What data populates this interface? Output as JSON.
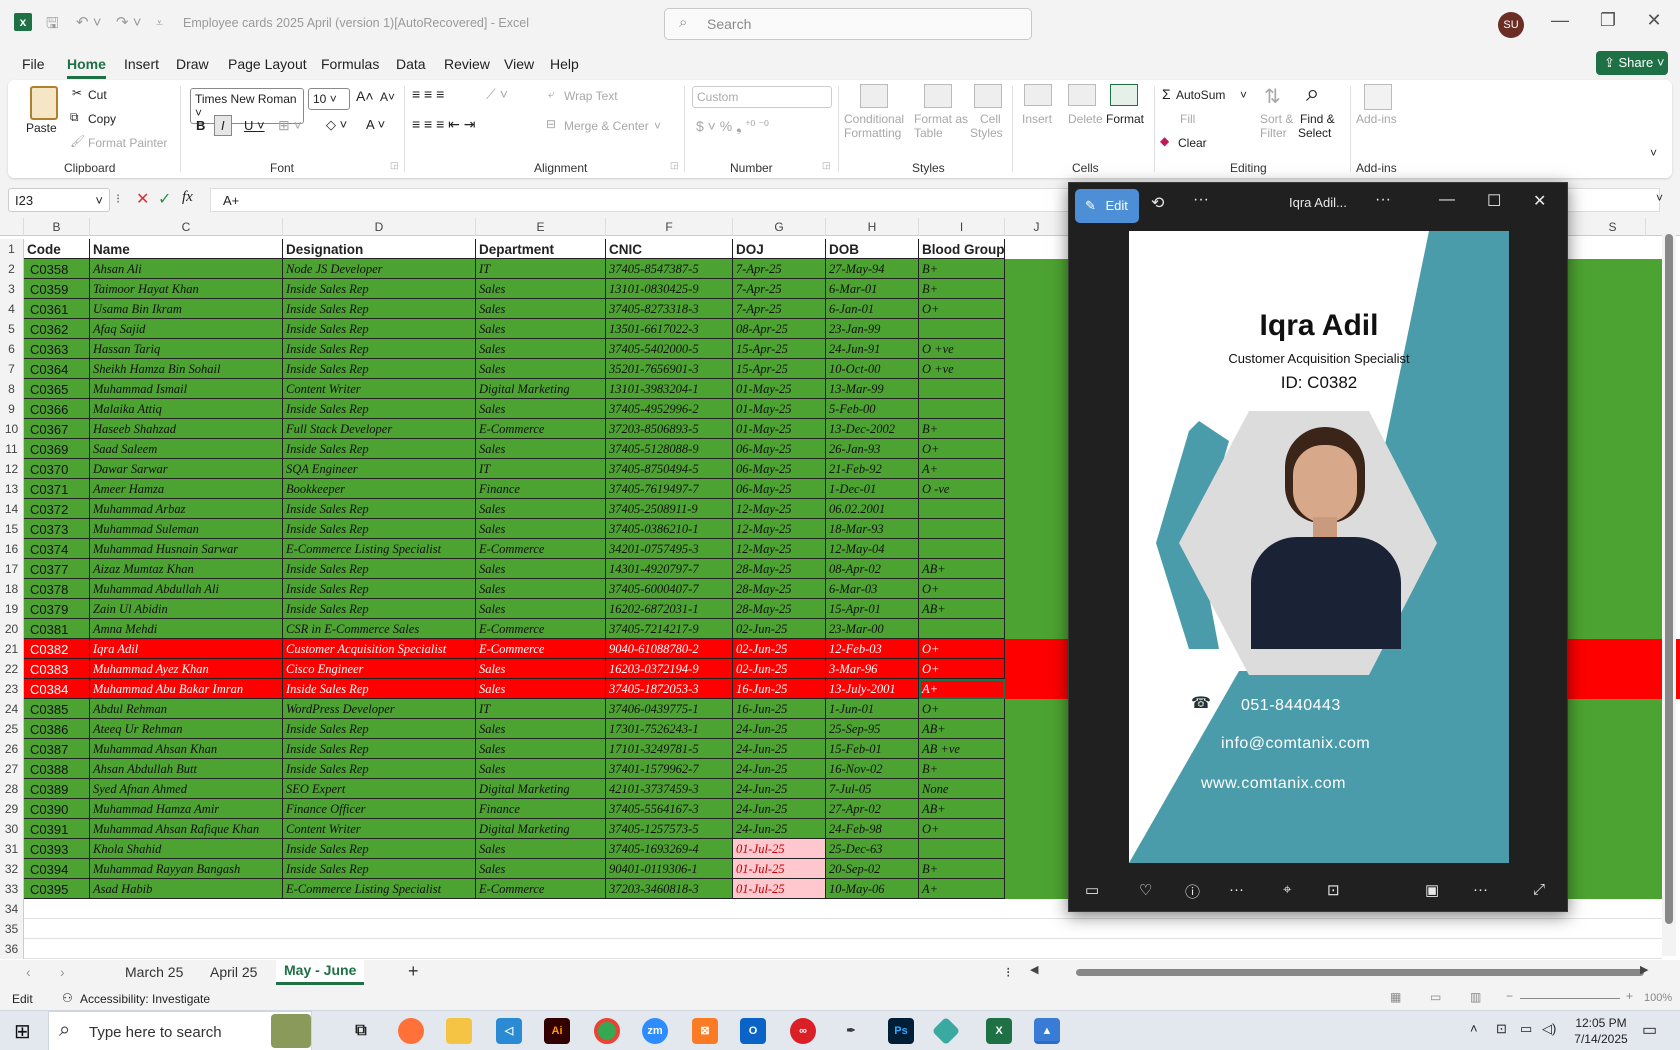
{
  "titlebar": {
    "doc_title": "Employee cards 2025 April (version 1)[AutoRecovered]  -  Excel",
    "search_placeholder": "Search",
    "user_initials": "SU"
  },
  "menu": [
    "File",
    "Home",
    "Insert",
    "Draw",
    "Page Layout",
    "Formulas",
    "Data",
    "Review",
    "View",
    "Help"
  ],
  "share_label": "Share",
  "ribbon": {
    "clipboard": {
      "paste": "Paste",
      "cut": "Cut",
      "copy": "Copy",
      "format_painter": "Format Painter",
      "group": "Clipboard"
    },
    "font": {
      "name": "Times New Roman",
      "size": "10",
      "group": "Font"
    },
    "alignment": {
      "wrap_text": "Wrap Text",
      "merge_center": "Merge & Center",
      "group": "Alignment"
    },
    "number": {
      "format": "Custom",
      "group": "Number"
    },
    "styles": {
      "conditional_1": "Conditional",
      "conditional_2": "Formatting",
      "format_table_1": "Format as",
      "format_table_2": "Table",
      "cell_styles_1": "Cell",
      "cell_styles_2": "Styles",
      "group": "Styles"
    },
    "cells": {
      "insert": "Insert",
      "delete": "Delete",
      "format": "Format",
      "group": "Cells"
    },
    "editing": {
      "autosum": "AutoSum",
      "fill": "Fill",
      "clear": "Clear",
      "sort_1": "Sort &",
      "sort_2": "Filter",
      "find_1": "Find &",
      "find_2": "Select",
      "group": "Editing"
    },
    "addins": {
      "label": "Add-ins",
      "group": "Add-ins"
    }
  },
  "formula_bar": {
    "name_box": "I23",
    "formula": "A+"
  },
  "columns": [
    "B",
    "C",
    "D",
    "E",
    "F",
    "G",
    "H",
    "I",
    "J",
    "S"
  ],
  "headers": [
    "Code",
    "Name",
    "Designation",
    "Department",
    "CNIC",
    "DOJ",
    "DOB",
    "Blood Group"
  ],
  "rows": [
    {
      "n": "2",
      "c": [
        "C0358",
        "Ahsan Ali",
        "Node JS Developer",
        "IT",
        "37405-8547387-5",
        "7-Apr-25",
        "27-May-94",
        "B+"
      ]
    },
    {
      "n": "3",
      "c": [
        "C0359",
        "Taimoor Hayat Khan",
        "Inside Sales Rep",
        "Sales",
        "13101-0830425-9",
        "7-Apr-25",
        "6-Mar-01",
        "B+"
      ]
    },
    {
      "n": "4",
      "c": [
        "C0361",
        "Usama Bin Ikram",
        "Inside Sales Rep",
        "Sales",
        "37405-8273318-3",
        "7-Apr-25",
        "6-Jan-01",
        "O+"
      ]
    },
    {
      "n": "5",
      "c": [
        "C0362",
        "Afaq Sajid",
        "Inside Sales Rep",
        "Sales",
        "13501-6617022-3",
        "08-Apr-25",
        "23-Jan-99",
        ""
      ]
    },
    {
      "n": "6",
      "c": [
        "C0363",
        "Hassan Tariq",
        "Inside Sales Rep",
        "Sales",
        "37405-5402000-5",
        "15-Apr-25",
        "24-Jun-91",
        "O +ve"
      ]
    },
    {
      "n": "7",
      "c": [
        "C0364",
        "Sheikh Hamza Bin Sohail",
        "Inside Sales Rep",
        "Sales",
        "35201-7656901-3",
        "15-Apr-25",
        "10-Oct-00",
        "O +ve"
      ]
    },
    {
      "n": "8",
      "c": [
        "C0365",
        "Muhammad Ismail",
        "Content Writer",
        "Digital Marketing",
        "13101-3983204-1",
        "01-May-25",
        "13-Mar-99",
        ""
      ]
    },
    {
      "n": "9",
      "c": [
        "C0366",
        "Malaika Attiq",
        "Inside Sales Rep",
        "Sales",
        "37405-4952996-2",
        "01-May-25",
        "5-Feb-00",
        ""
      ]
    },
    {
      "n": "10",
      "c": [
        "C0367",
        "Haseeb Shahzad",
        "Full Stack Developer",
        "E-Commerce",
        "37203-8506893-5",
        "01-May-25",
        "13-Dec-2002",
        "B+"
      ]
    },
    {
      "n": "11",
      "c": [
        "C0369",
        "Saad Saleem",
        "Inside Sales Rep",
        "Sales",
        "37405-5128088-9",
        "06-May-25",
        "26-Jan-93",
        "O+"
      ]
    },
    {
      "n": "12",
      "c": [
        "C0370",
        "Dawar Sarwar",
        "SQA Engineer",
        "IT",
        "37405-8750494-5",
        "06-May-25",
        "21-Feb-92",
        "A+"
      ]
    },
    {
      "n": "13",
      "c": [
        "C0371",
        "Ameer Hamza",
        "Bookkeeper",
        "Finance",
        "37405-7619497-7",
        "06-May-25",
        "1-Dec-01",
        "O -ve"
      ]
    },
    {
      "n": "14",
      "c": [
        "C0372",
        "Muhammad Arbaz",
        "Inside Sales Rep",
        "Sales",
        "37405-2508911-9",
        "12-May-25",
        "06.02.2001",
        ""
      ]
    },
    {
      "n": "15",
      "c": [
        "C0373",
        "Muhammad Suleman",
        "Inside Sales Rep",
        "Sales",
        "37405-0386210-1",
        "12-May-25",
        "18-Mar-93",
        ""
      ]
    },
    {
      "n": "16",
      "c": [
        "C0374",
        "Muhammad Husnain Sarwar",
        "E-Commerce Listing Specialist",
        "E-Commerce",
        "34201-0757495-3",
        "12-May-25",
        "12-May-04",
        ""
      ]
    },
    {
      "n": "17",
      "c": [
        "C0377",
        "Aizaz Mumtaz Khan",
        "Inside Sales Rep",
        "Sales",
        "14301-4920797-7",
        "28-May-25",
        "08-Apr-02",
        "AB+"
      ]
    },
    {
      "n": "18",
      "c": [
        "C0378",
        "Muhammad Abdullah Ali",
        "Inside Sales Rep",
        "Sales",
        "37405-6000407-7",
        "28-May-25",
        "6-Mar-03",
        "O+"
      ]
    },
    {
      "n": "19",
      "c": [
        "C0379",
        "Zain Ul Abidin",
        "Inside Sales Rep",
        "Sales",
        "16202-6872031-1",
        "28-May-25",
        "15-Apr-01",
        "AB+"
      ]
    },
    {
      "n": "20",
      "c": [
        "C0381",
        "Amna Mehdi",
        "CSR in E-Commerce Sales",
        "E-Commerce",
        "37405-7214217-9",
        "02-Jun-25",
        "23-Mar-00",
        ""
      ]
    },
    {
      "n": "21",
      "c": [
        "C0382",
        "Iqra Adil",
        "Customer Acquisition Specialist",
        "E-Commerce",
        "9040-61088780-2",
        "02-Jun-25",
        "12-Feb-03",
        "O+"
      ]
    },
    {
      "n": "22",
      "c": [
        "C0383",
        "Muhammad Ayez Khan",
        "Cisco Engineer",
        "Sales",
        "16203-0372194-9",
        "02-Jun-25",
        "3-Mar-96",
        "O+"
      ]
    },
    {
      "n": "23",
      "c": [
        "C0384",
        "Muhammad Abu Bakar Imran",
        "Inside Sales Rep",
        "Sales",
        "37405-1872053-3",
        "16-Jun-25",
        "13-July-2001",
        "A+"
      ]
    },
    {
      "n": "24",
      "c": [
        "C0385",
        "Abdul Rehman",
        "WordPress Developer",
        "IT",
        "37406-0439775-1",
        "16-Jun-25",
        "1-Jun-01",
        "O+"
      ]
    },
    {
      "n": "25",
      "c": [
        "C0386",
        "Ateeq Ur Rehman",
        "Inside Sales Rep",
        "Sales",
        "17301-7526243-1",
        "24-Jun-25",
        "25-Sep-95",
        "AB+"
      ]
    },
    {
      "n": "26",
      "c": [
        "C0387",
        "Muhammad Ahsan Khan",
        "Inside Sales Rep",
        "Sales",
        "17101-3249781-5",
        "24-Jun-25",
        "15-Feb-01",
        "AB +ve"
      ]
    },
    {
      "n": "27",
      "c": [
        "C0388",
        "Ahsan Abdullah Butt",
        "Inside Sales Rep",
        "Sales",
        "37401-1579962-7",
        "24-Jun-25",
        "16-Nov-02",
        "B+"
      ]
    },
    {
      "n": "28",
      "c": [
        "C0389",
        "Syed Afnan Ahmed",
        "SEO Expert",
        "Digital Marketing",
        "42101-3737459-3",
        "24-Jun-25",
        "7-Jul-05",
        "None"
      ]
    },
    {
      "n": "29",
      "c": [
        "C0390",
        "Muhammad Hamza Amir",
        "Finance Officer",
        "Finance",
        "37405-5564167-3",
        "24-Jun-25",
        "27-Apr-02",
        "AB+"
      ]
    },
    {
      "n": "30",
      "c": [
        "C0391",
        "Muhammad Ahsan Rafique Khan",
        "Content Writer",
        "Digital Marketing",
        "37405-1257573-5",
        "24-Jun-25",
        "24-Feb-98",
        "O+"
      ]
    },
    {
      "n": "31",
      "c": [
        "C0393",
        "Khola Shahid",
        "Inside Sales Rep",
        "Sales",
        "37405-1693269-4",
        "01-Jul-25",
        "25-Dec-63",
        ""
      ]
    },
    {
      "n": "32",
      "c": [
        "C0394",
        "Muhammad Rayyan Bangash",
        "Inside Sales Rep",
        "Sales",
        "90401-0119306-1",
        "01-Jul-25",
        "20-Sep-02",
        "B+"
      ]
    },
    {
      "n": "33",
      "c": [
        "C0395",
        "Asad Habib",
        "E-Commerce Listing Specialist",
        "E-Commerce",
        "37203-3460818-3",
        "01-Jul-25",
        "10-May-06",
        "A+"
      ]
    }
  ],
  "empty_rows": [
    "34",
    "35",
    "36"
  ],
  "sheet_tabs": [
    "March 25",
    "April 25",
    "May - June"
  ],
  "status": {
    "mode": "Edit",
    "accessibility": "Accessibility: Investigate",
    "zoom": "100%"
  },
  "photos": {
    "edit_label": "Edit",
    "title": "Iqra Adil...",
    "card": {
      "name": "Iqra Adil",
      "role": "Customer Acquisition Specialist",
      "id": "ID: C0382",
      "phone": "051-8440443",
      "email": "info@comtanix.com",
      "web": "www.comtanix.com"
    }
  },
  "taskbar": {
    "search_placeholder": "Type here to search",
    "time": "12:05 PM",
    "date": "7/14/2025"
  },
  "colors": {
    "green": "#4da331",
    "red": "#fe0000",
    "pink": "#ffc7ce",
    "excel_green": "#1e7145",
    "teal": "#4b9caa"
  }
}
